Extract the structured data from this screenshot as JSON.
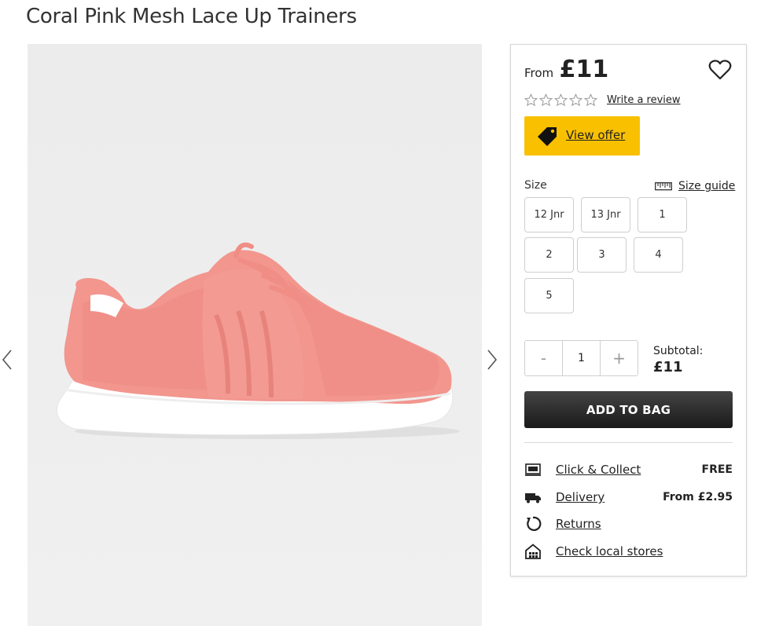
{
  "product": {
    "title": "Coral Pink Mesh Lace Up Trainers"
  },
  "gallery": {
    "prev_icon": "chevron-left-icon",
    "next_icon": "chevron-right-icon"
  },
  "pricing": {
    "from_label": "From",
    "price": "£11"
  },
  "reviews": {
    "rating": 0,
    "max_rating": 5,
    "write_review_label": "Write a review"
  },
  "offer": {
    "label": "View offer",
    "color": "#f9c000"
  },
  "size": {
    "label": "Size",
    "guide_label": "Size guide",
    "options": [
      "12 Jnr",
      "13 Jnr",
      "1",
      "2",
      "3",
      "4",
      "5"
    ]
  },
  "quantity": {
    "minus_label": "-",
    "value": "1",
    "plus_label": "+",
    "subtotal_label": "Subtotal:",
    "subtotal_value": "£11"
  },
  "cart": {
    "add_label": "ADD TO BAG"
  },
  "services": [
    {
      "label": "Click & Collect",
      "value": "FREE",
      "icon": "click-collect-icon"
    },
    {
      "label": "Delivery",
      "value": "From £2.95",
      "icon": "delivery-truck-icon"
    },
    {
      "label": "Returns",
      "value": "",
      "icon": "returns-icon"
    },
    {
      "label": "Check local stores",
      "value": "",
      "icon": "store-icon"
    }
  ]
}
